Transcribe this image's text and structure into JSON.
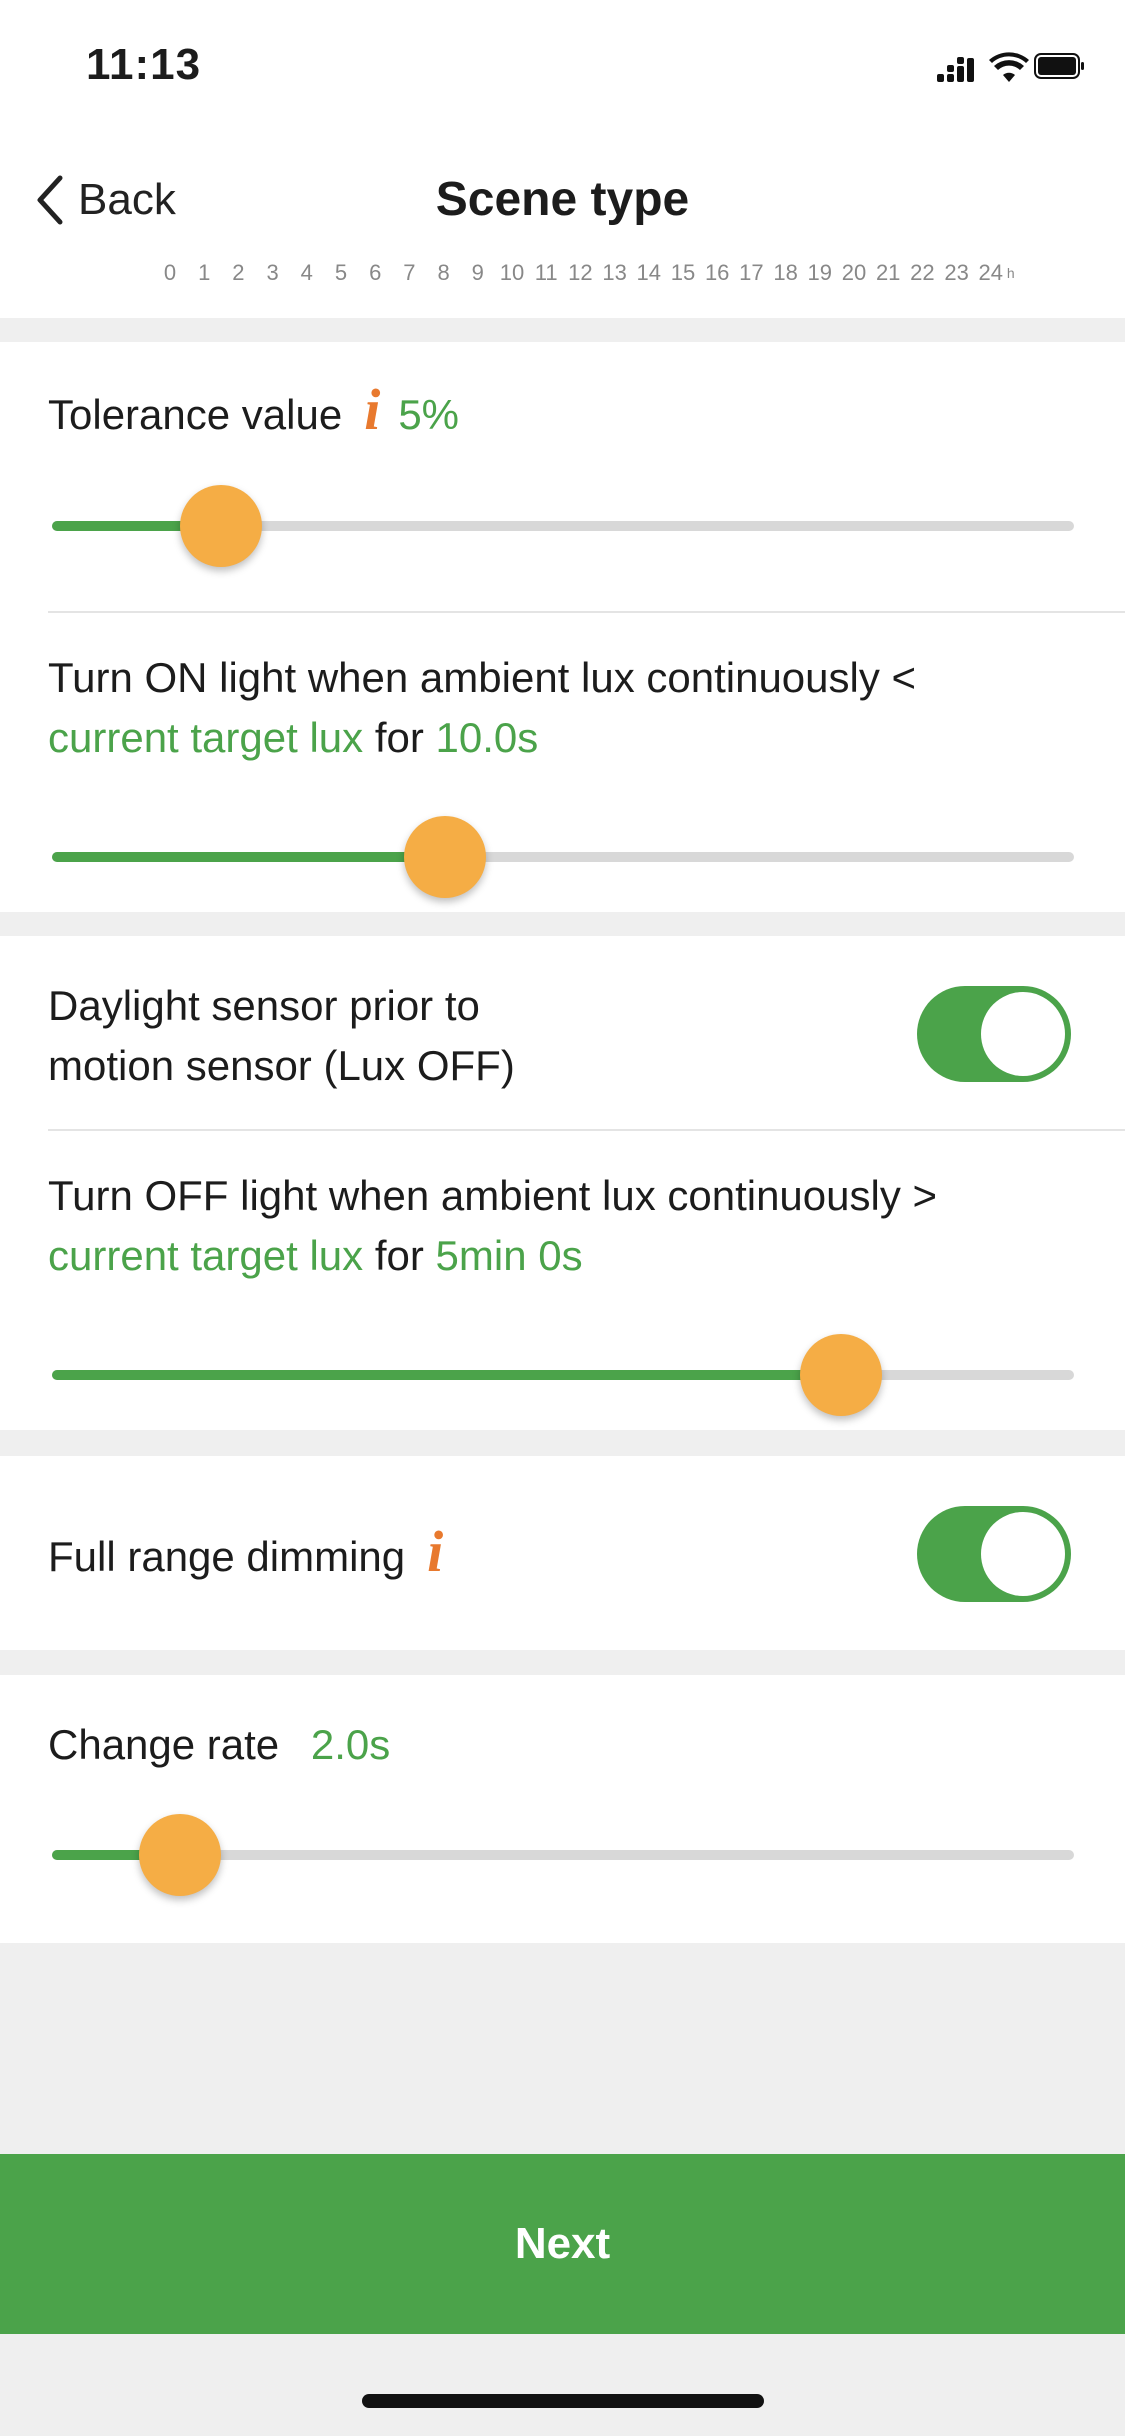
{
  "status_bar": {
    "time": "11:13"
  },
  "nav": {
    "back_label": "Back",
    "title": "Scene type"
  },
  "hour_ticks": [
    "0",
    "1",
    "2",
    "3",
    "4",
    "5",
    "6",
    "7",
    "8",
    "9",
    "10",
    "11",
    "12",
    "13",
    "14",
    "15",
    "16",
    "17",
    "18",
    "19",
    "20",
    "21",
    "22",
    "23",
    "24",
    "h"
  ],
  "tolerance": {
    "label": "Tolerance value",
    "value": "5%",
    "slider_fraction": 0.165
  },
  "lux_on": {
    "text_prefix": "Turn ON light when ambient lux continuously <",
    "target": "current target lux",
    "for_word": "for",
    "duration": "10.0s",
    "slider_fraction": 0.385
  },
  "daylight_priority": {
    "line1": "Daylight sensor prior to",
    "line2": "motion sensor (Lux OFF)",
    "enabled": true
  },
  "lux_off": {
    "text_prefix": "Turn OFF light when ambient lux continuously >",
    "target": "current target lux",
    "for_word": "for",
    "duration": "5min 0s",
    "slider_fraction": 0.772
  },
  "full_range_dimming": {
    "label": "Full range dimming",
    "enabled": true
  },
  "change_rate": {
    "label": "Change rate",
    "value": "2.0s",
    "slider_fraction": 0.125
  },
  "next_button": {
    "label": "Next"
  },
  "colors": {
    "accent_green": "#4ba34a",
    "thumb_orange": "#f5ad45",
    "info_orange": "#e8792e"
  }
}
